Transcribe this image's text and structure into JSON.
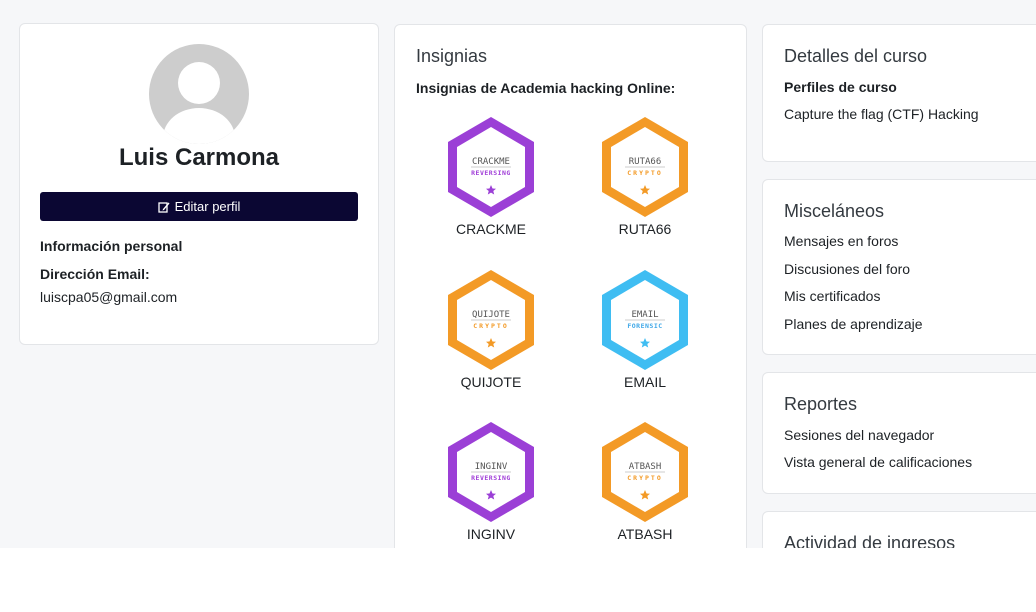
{
  "profile": {
    "name": "Luis Carmona",
    "edit_button": "Editar perfil",
    "personal_info_heading": "Información personal",
    "email_label": "Dirección Email:",
    "email_value": "luiscpa05@gmail.com"
  },
  "badges": {
    "title": "Insignias",
    "subtitle": "Insignias de Academia hacking Online:",
    "items": [
      {
        "name": "CRACKME",
        "logo_text": "CRACKME",
        "category": "REVERSING",
        "color": "#9b3fd6",
        "accent": "#a13fd8"
      },
      {
        "name": "RUTA66",
        "logo_text": "RUTA66",
        "category": "CRYPTO",
        "color": "#f39a26",
        "accent": "#f39a26"
      },
      {
        "name": "QUIJOTE",
        "logo_text": "QUIJOTE",
        "category": "CRYPTO",
        "color": "#f39a26",
        "accent": "#f39a26"
      },
      {
        "name": "EMAIL",
        "logo_text": "EMAIL",
        "category": "FORENSIC",
        "color": "#3fbdf2",
        "accent": "#3fa8e8"
      },
      {
        "name": "INGINV",
        "logo_text": "INGINV",
        "category": "REVERSING",
        "color": "#9b3fd6",
        "accent": "#a13fd8"
      },
      {
        "name": "ATBASH",
        "logo_text": "ATBASH",
        "category": "CRYPTO",
        "color": "#f39a26",
        "accent": "#f39a26"
      }
    ]
  },
  "course": {
    "title": "Detalles del curso",
    "profiles_label": "Perfiles de curso",
    "course_link": "Capture the flag (CTF) Hacking"
  },
  "misc": {
    "title": "Misceláneos",
    "links": [
      "Mensajes en foros",
      "Discusiones del foro",
      "Mis certificados",
      "Planes de aprendizaje"
    ]
  },
  "reports": {
    "title": "Reportes",
    "links": [
      "Sesiones del navegador",
      "Vista general de calificaciones"
    ]
  },
  "activity": {
    "title": "Actividad de ingresos"
  },
  "colors": {
    "button_bg": "#0b0733",
    "purple": "#9b3fd6",
    "orange": "#f39a26",
    "blue": "#3fbdf2"
  }
}
